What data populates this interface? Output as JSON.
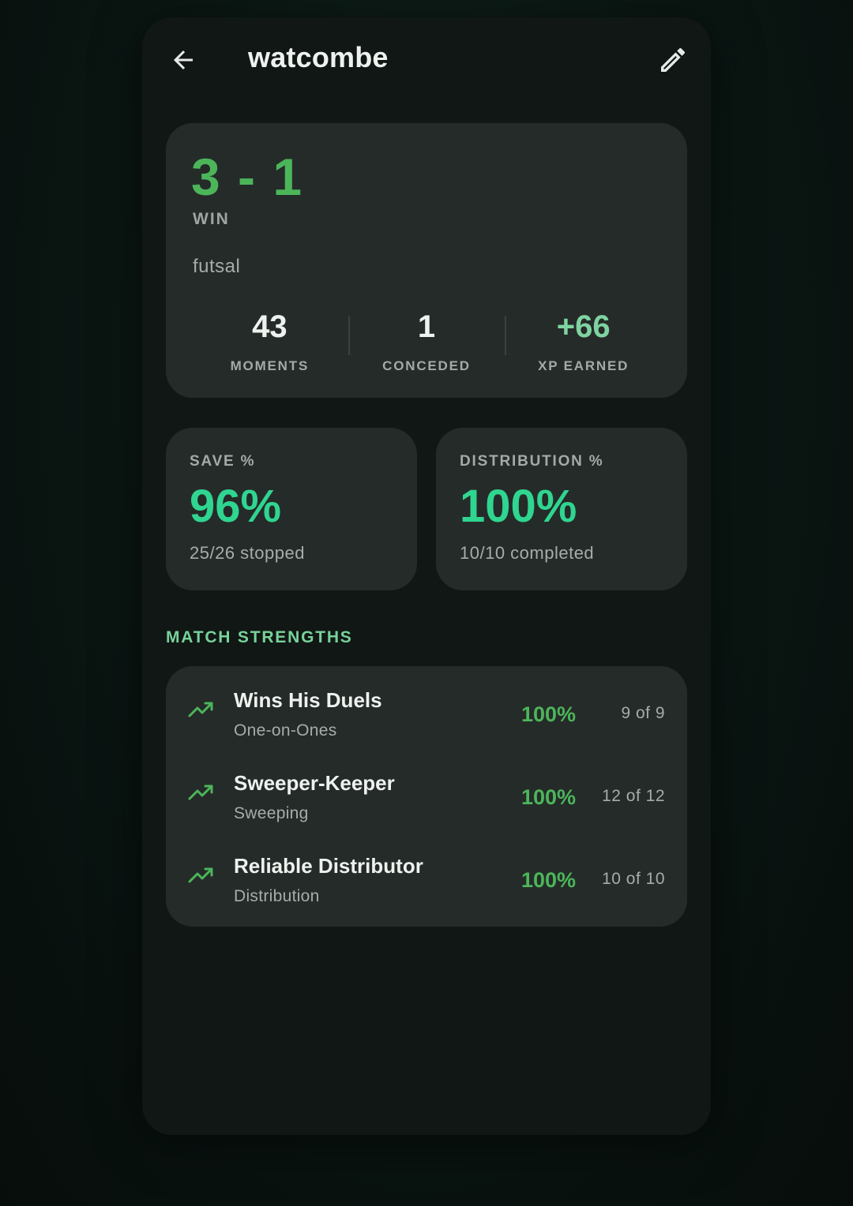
{
  "header": {
    "title": "watcombe",
    "back_icon": "arrow-left-icon",
    "edit_icon": "pencil-icon"
  },
  "summary": {
    "score": "3 - 1",
    "result": "WIN",
    "format": "futsal",
    "stats": [
      {
        "value": "43",
        "label": "MOMENTS"
      },
      {
        "value": "1",
        "label": "CONCEDED"
      },
      {
        "value": "+66",
        "label": "XP EARNED"
      }
    ]
  },
  "metrics": {
    "save": {
      "label": "SAVE %",
      "value": "96%",
      "sub": "25/26 stopped"
    },
    "distribution": {
      "label": "DISTRIBUTION %",
      "value": "100%",
      "sub": "10/10 completed"
    }
  },
  "strengths": {
    "title": "MATCH STRENGTHS",
    "items": [
      {
        "name": "Wins His Duels",
        "category": "One-on-Ones",
        "pct": "100%",
        "count": "9 of 9",
        "icon": "trending-up-icon"
      },
      {
        "name": "Sweeper-Keeper",
        "category": "Sweeping",
        "pct": "100%",
        "count": "12 of 12",
        "icon": "trending-up-icon"
      },
      {
        "name": "Reliable Distributor",
        "category": "Distribution",
        "pct": "100%",
        "count": "10 of 10",
        "icon": "trending-up-icon"
      }
    ]
  },
  "colors": {
    "accent_green": "#4cb55a",
    "metric_green": "#2fd590",
    "section_green": "#78d29a",
    "card_bg": "#252b29",
    "screen_bg": "#111715"
  }
}
